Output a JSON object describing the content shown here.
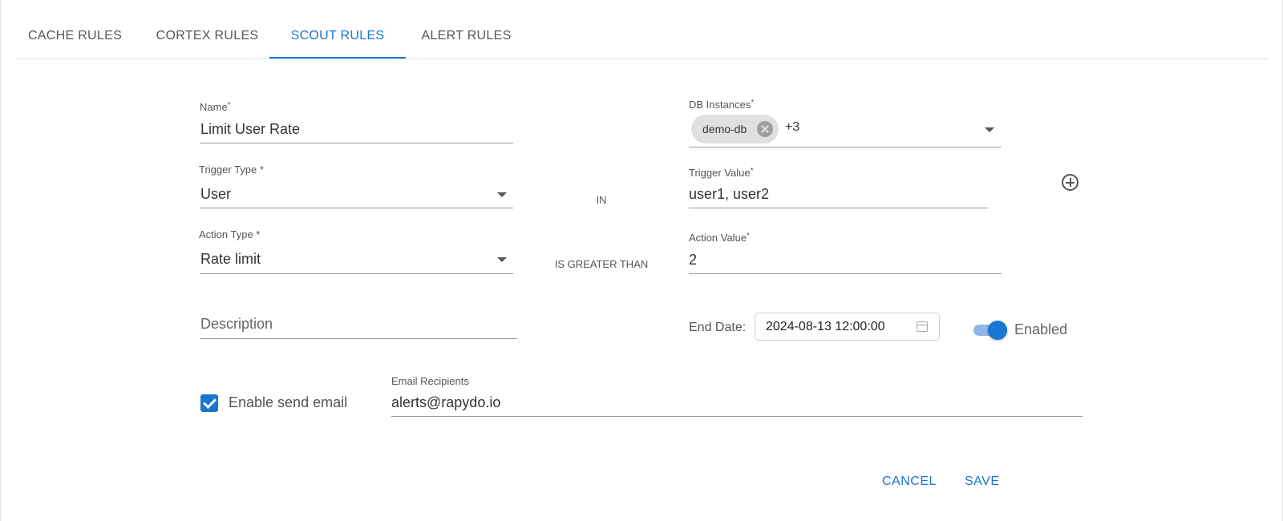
{
  "tabs": [
    {
      "label": "CACHE RULES"
    },
    {
      "label": "CORTEX RULES"
    },
    {
      "label": "SCOUT RULES"
    },
    {
      "label": "ALERT RULES"
    }
  ],
  "form": {
    "name": {
      "label": "Name",
      "required_mark": "*",
      "value": "Limit User Rate"
    },
    "db_instances": {
      "label": "DB Instances",
      "required_mark": "*",
      "chip": "demo-db",
      "more": "+3"
    },
    "trigger_type": {
      "label": "Trigger Type *",
      "value": "User"
    },
    "trigger_operator": "IN",
    "trigger_value": {
      "label": "Trigger Value",
      "required_mark": "*",
      "value": "user1, user2"
    },
    "action_type": {
      "label": "Action Type *",
      "value": "Rate limit"
    },
    "action_operator": "IS GREATER THAN",
    "action_value": {
      "label": "Action Value",
      "required_mark": "*",
      "value": "2"
    },
    "description": {
      "placeholder": "Description"
    },
    "end_date": {
      "label": "End Date:",
      "value": "2024-08-13 12:00:00"
    },
    "enabled": {
      "label": "Enabled",
      "checked": true
    },
    "enable_send_email": {
      "label": "Enable send email",
      "checked": true
    },
    "email_recipients": {
      "label": "Email Recipients",
      "value": "alerts@rapydo.io"
    }
  },
  "actions": {
    "cancel": "CANCEL",
    "save": "SAVE"
  },
  "colors": {
    "accent": "#1976d2",
    "toggle_track": "#8fb8e6",
    "chip_bg": "#e0e0e0"
  }
}
